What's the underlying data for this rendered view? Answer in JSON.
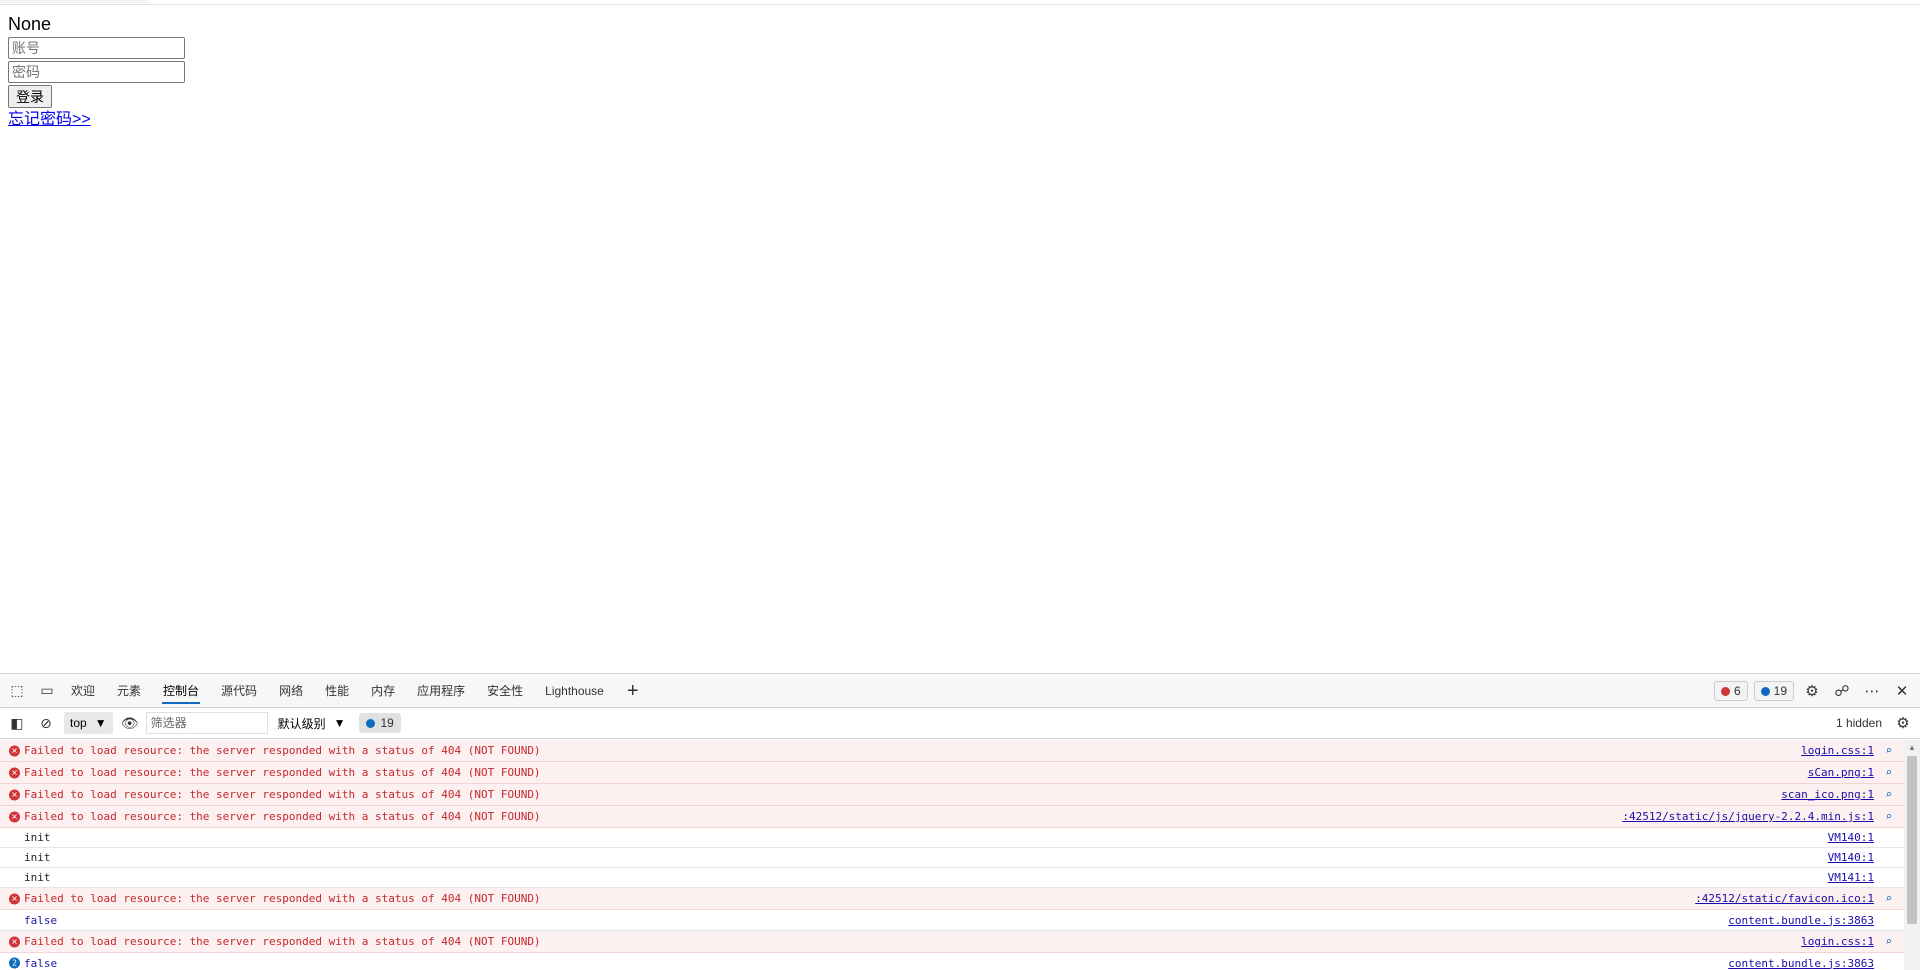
{
  "page": {
    "title": "None",
    "account_placeholder": "账号",
    "password_placeholder": "密码",
    "login_label": "登录",
    "forgot_label": "忘记密码>>"
  },
  "devtools": {
    "tabs": [
      "欢迎",
      "元素",
      "控制台",
      "源代码",
      "网络",
      "性能",
      "内存",
      "应用程序",
      "安全性",
      "Lighthouse"
    ],
    "active_tab": "控制台",
    "error_count": "6",
    "message_count": "19",
    "toolbar": {
      "context": "top",
      "filter_placeholder": "筛选器",
      "level": "默认级别",
      "message_count": "19",
      "hidden": "1 hidden"
    },
    "messages": [
      {
        "type": "error",
        "text": "Failed to load resource: the server responded with a status of 404 (NOT FOUND)",
        "source": "login.css:1"
      },
      {
        "type": "error",
        "text": "Failed to load resource: the server responded with a status of 404 (NOT FOUND)",
        "source": "sCan.png:1"
      },
      {
        "type": "error",
        "text": "Failed to load resource: the server responded with a status of 404 (NOT FOUND)",
        "source": "scan_ico.png:1"
      },
      {
        "type": "error",
        "text": "Failed to load resource: the server responded with a status of 404 (NOT FOUND)",
        "source": ":42512/static/js/jquery-2.2.4.min.js:1"
      },
      {
        "type": "log",
        "text": "init",
        "source": "VM140:1"
      },
      {
        "type": "log",
        "text": "init",
        "source": "VM140:1"
      },
      {
        "type": "log",
        "text": "init",
        "source": "VM141:1"
      },
      {
        "type": "error",
        "text": "Failed to load resource: the server responded with a status of 404 (NOT FOUND)",
        "source": ":42512/static/favicon.ico:1"
      },
      {
        "type": "value",
        "text": "false",
        "source": "content.bundle.js:3863"
      },
      {
        "type": "error",
        "text": "Failed to load resource: the server responded with a status of 404 (NOT FOUND)",
        "source": "login.css:1"
      },
      {
        "type": "value-repeat",
        "repeat": "2",
        "text": "false",
        "source": "content.bundle.js:3863"
      }
    ]
  },
  "colors": {
    "error_text": "#c4282b",
    "error_bg": "#fdf0f0",
    "accent": "#0f6cbd",
    "link": "#1a0dab"
  }
}
